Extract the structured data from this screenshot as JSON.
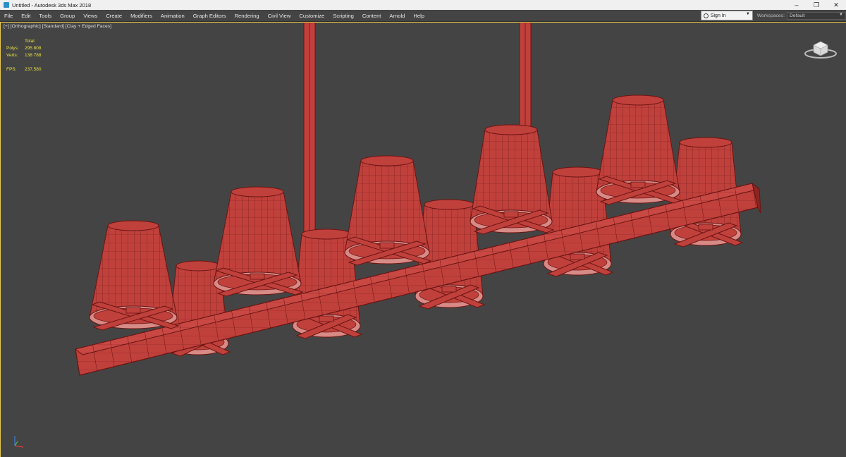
{
  "window": {
    "title": "Untitled - Autodesk 3ds Max 2018",
    "minimize": "–",
    "restore": "❐",
    "close": "✕"
  },
  "menu": [
    "File",
    "Edit",
    "Tools",
    "Group",
    "Views",
    "Create",
    "Modifiers",
    "Animation",
    "Graph Editors",
    "Rendering",
    "Civil View",
    "Customize",
    "Scripting",
    "Content",
    "Arnold",
    "Help"
  ],
  "account": {
    "sign_in": "Sign In",
    "workspaces_label": "Workspaces:",
    "workspace": "Default"
  },
  "viewport": {
    "label": "[+] [Orthographic] [Standard] [Clay + Edged Faces]",
    "stats": {
      "header": "Total",
      "polys_label": "Polys:",
      "polys": "295 808",
      "verts_label": "Verts:",
      "verts": "138 788",
      "fps_label": "FPS:",
      "fps": "237,580"
    }
  },
  "colors": {
    "mesh": "#c0403c",
    "wire": "#6a1512",
    "background": "#444444",
    "stats": "#e8e040",
    "active_border": "#e8c94c"
  },
  "icons": [
    "app-icon",
    "user-icon",
    "viewcube-icon",
    "axis-tripod-icon"
  ]
}
